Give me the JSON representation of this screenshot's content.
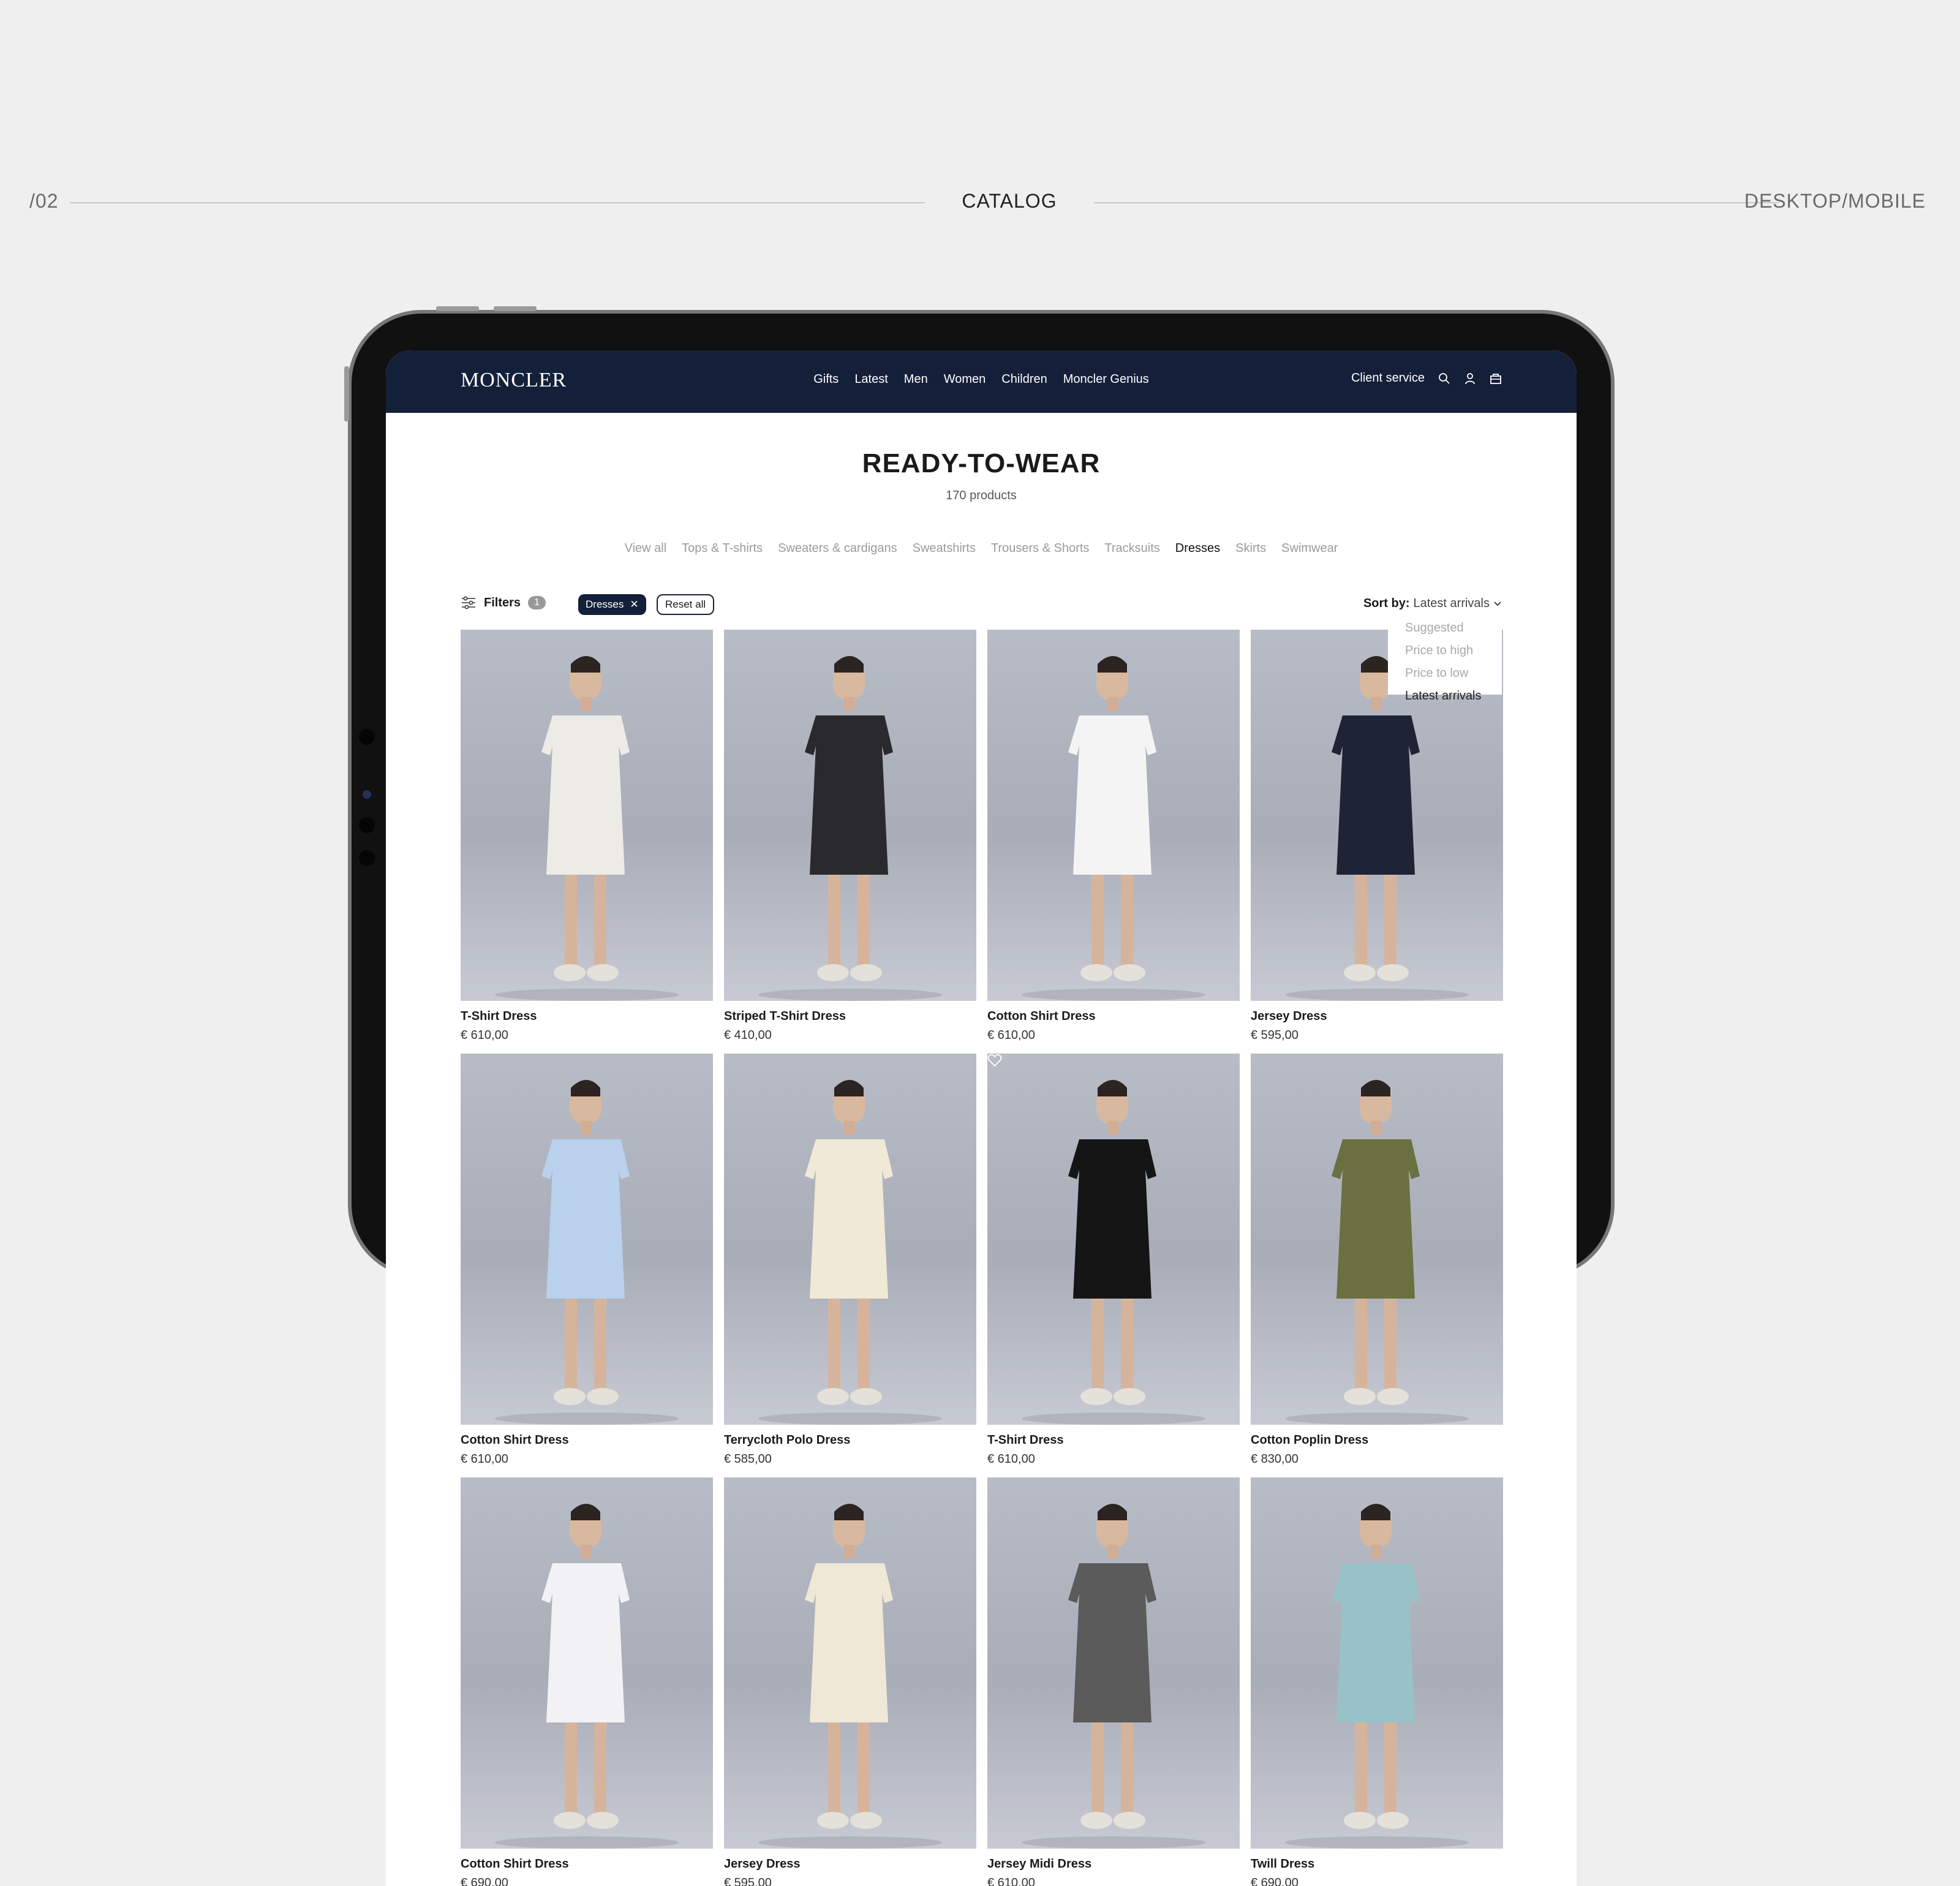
{
  "section": {
    "number": "/02",
    "title": "CATALOG",
    "right_label": "DESKTOP/MOBILE"
  },
  "nav": {
    "logo": "MONCLER",
    "items": [
      "Gifts",
      "Latest",
      "Men",
      "Women",
      "Children",
      "Moncler Genius"
    ],
    "client_service": "Client service",
    "icons": [
      "search-icon",
      "user-icon",
      "bag-icon"
    ]
  },
  "page": {
    "title": "READY-TO-WEAR",
    "count": "170 products"
  },
  "categories": [
    "View all",
    "Tops & T-shirts",
    "Sweaters & cardigans",
    "Sweatshirts",
    "Trousers & Shorts",
    "Tracksuits",
    "Dresses",
    "Skirts",
    "Swimwear"
  ],
  "active_category": "Dresses",
  "toolbar": {
    "filters_label": "Filters",
    "filters_count": "1",
    "active_chip": "Dresses",
    "reset_label": "Reset all",
    "sort_label": "Sort by:",
    "sort_value": "Latest arrivals"
  },
  "sort_options": [
    "Suggested",
    "Price to high",
    "Price to low",
    "Latest arrivals"
  ],
  "products": [
    {
      "name": "T-Shirt Dress",
      "price": "€ 610,00",
      "dress_color": "#ecebe6"
    },
    {
      "name": "Striped T-Shirt Dress",
      "price": "€ 410,00",
      "dress_color": "#2a2a2e"
    },
    {
      "name": "Cotton Shirt Dress",
      "price": "€ 610,00",
      "dress_color": "#f4f4f4"
    },
    {
      "name": "Jersey Dress",
      "price": "€ 595,00",
      "dress_color": "#1e2436"
    },
    {
      "name": "Cotton Shirt Dress",
      "price": "€ 610,00",
      "dress_color": "#b9d1ec"
    },
    {
      "name": "Terrycloth Polo Dress",
      "price": "€ 585,00",
      "dress_color": "#efe9d6"
    },
    {
      "name": "T-Shirt Dress",
      "price": "€ 610,00",
      "dress_color": "#151515"
    },
    {
      "name": "Cotton Poplin Dress",
      "price": "€ 830,00",
      "dress_color": "#6b7040"
    },
    {
      "name": "Cotton Shirt Dress",
      "price": "€ 690,00",
      "dress_color": "#f2f2f5"
    },
    {
      "name": "Jersey Dress",
      "price": "€ 595,00",
      "dress_color": "#efe8d6"
    },
    {
      "name": "Jersey Midi Dress",
      "price": "€ 610,00",
      "dress_color": "#5b5b5b"
    },
    {
      "name": "Twill Dress",
      "price": "€ 690,00",
      "dress_color": "#98c2c8"
    }
  ]
}
